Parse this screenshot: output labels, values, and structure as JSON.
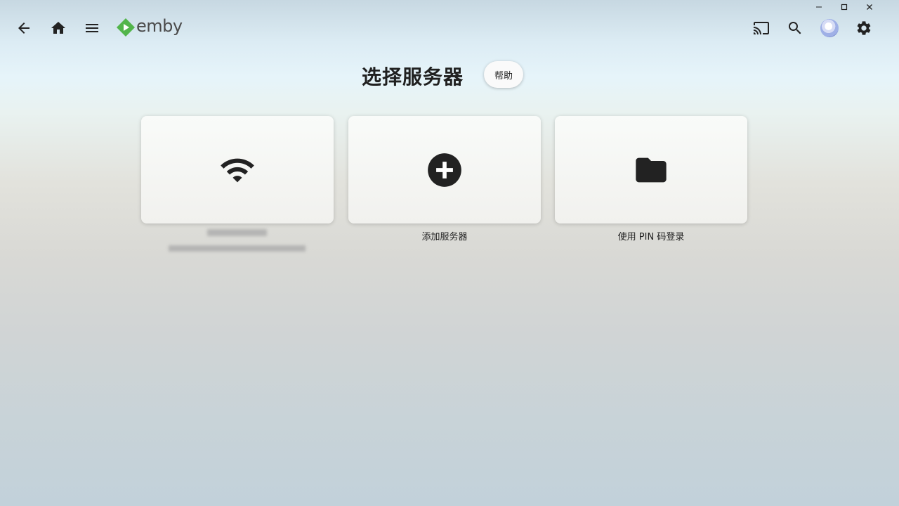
{
  "window": {
    "minimize_glyph": "–",
    "maximize_glyph": "☐",
    "close_glyph": "✕"
  },
  "header": {
    "logo_text": "emby",
    "icons": [
      "back-arrow-icon",
      "home-icon",
      "menu-icon",
      "cast-icon",
      "search-icon",
      "settings-icon"
    ],
    "logo_color": "#52b54b"
  },
  "page": {
    "title": "选择服务器",
    "help_label": "帮助"
  },
  "cards": [
    {
      "icon": "wifi-icon",
      "label": "",
      "sublabel": ""
    },
    {
      "icon": "add-circle-icon",
      "label": "添加服务器"
    },
    {
      "icon": "folder-icon",
      "label": "使用 PIN 码登录"
    }
  ]
}
